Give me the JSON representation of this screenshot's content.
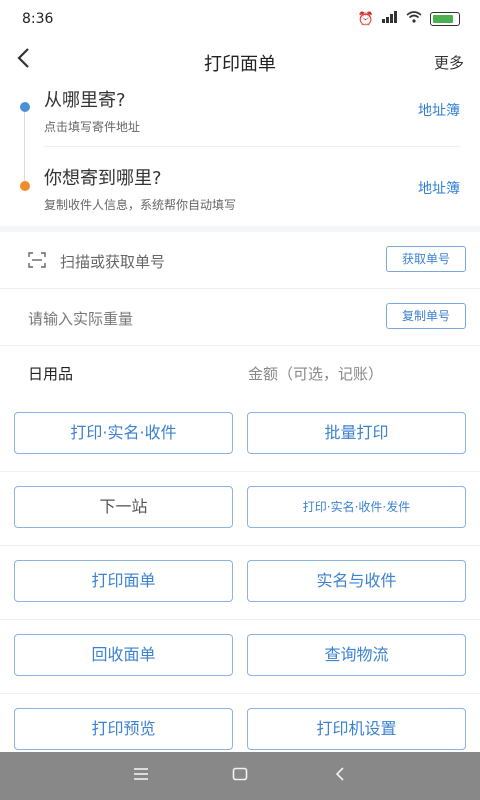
{
  "status": {
    "time": "8:36"
  },
  "nav": {
    "title": "打印面单",
    "more": "更多"
  },
  "address": {
    "sender": {
      "title": "从哪里寄?",
      "hint": "点击填写寄件地址",
      "link": "地址簿"
    },
    "receiver": {
      "title": "你想寄到哪里?",
      "hint": "复制收件人信息，系统帮你自动填写",
      "link": "地址簿"
    },
    "colors": {
      "sender_dot": "#4a90d9",
      "receiver_dot": "#f08c2a"
    }
  },
  "form": {
    "scan_label": "扫描或获取单号",
    "get_button": "获取单号",
    "weight_placeholder": "请输入实际重量",
    "copy_button": "复制单号",
    "goods": "日用品",
    "amount_placeholder": "金额（可选，记账）"
  },
  "actions": [
    {
      "left": "打印·实名·收件",
      "right": "批量打印"
    },
    {
      "left": "下一站",
      "right": "打印·实名·收件·发件"
    },
    {
      "left": "打印面单",
      "right": "实名与收件"
    },
    {
      "left": "回收面单",
      "right": "查询物流"
    },
    {
      "left": "打印预览",
      "right": "打印机设置"
    }
  ],
  "accent_color": "#3c82d0"
}
